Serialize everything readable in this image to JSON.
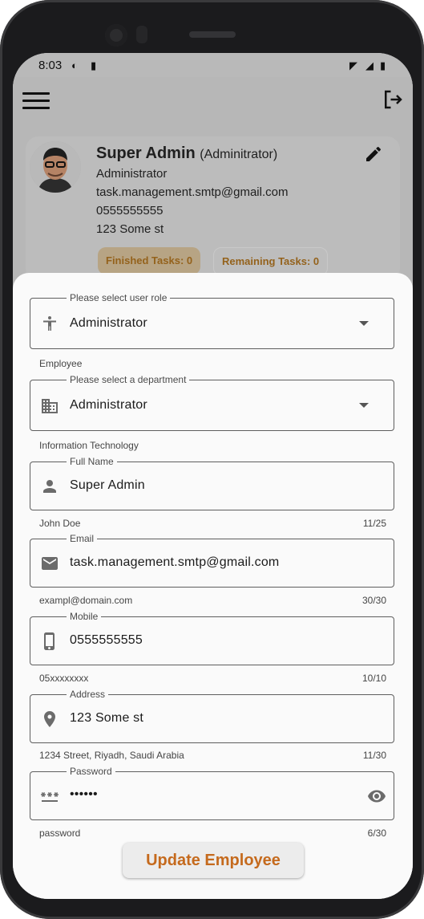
{
  "status_bar": {
    "time": "8:03"
  },
  "profile": {
    "name": "Super Admin",
    "role_paren": "(Adminitrator)",
    "role": "Administrator",
    "email": "task.management.smtp@gmail.com",
    "phone": "0555555555",
    "address": "123 Some st",
    "finished_tasks": "Finished Tasks: 0",
    "remaining_tasks": "Remaining Tasks: 0"
  },
  "form": {
    "role": {
      "label": "Please select user role",
      "value": "Administrator",
      "helper": "Employee",
      "icon": "accessibility-icon"
    },
    "department": {
      "label": "Please select a department",
      "value": "Administrator",
      "helper": "Information Technology",
      "icon": "building-icon"
    },
    "full_name": {
      "label": "Full Name",
      "value": "Super Admin",
      "helper": "John Doe",
      "counter": "11/25",
      "icon": "person-icon"
    },
    "email": {
      "label": "Email",
      "value": "task.management.smtp@gmail.com",
      "helper": "exampl@domain.com",
      "counter": "30/30",
      "icon": "mail-icon"
    },
    "mobile": {
      "label": "Mobile",
      "value": "0555555555",
      "helper": "05xxxxxxxx",
      "counter": "10/10",
      "icon": "phone-icon"
    },
    "address": {
      "label": "Address",
      "value": "123 Some st",
      "helper": "1234 Street, Riyadh, Saudi Arabia",
      "counter": "11/30",
      "icon": "location-pin-icon"
    },
    "password": {
      "label": "Password",
      "value": "••••••",
      "helper": "password",
      "counter": "6/30",
      "icon": "password-icon"
    }
  },
  "update_button": "Update Employee",
  "colors": {
    "accent": "#c56a1d",
    "overlay": "#b7b7b7",
    "sheet": "#fafafa"
  }
}
